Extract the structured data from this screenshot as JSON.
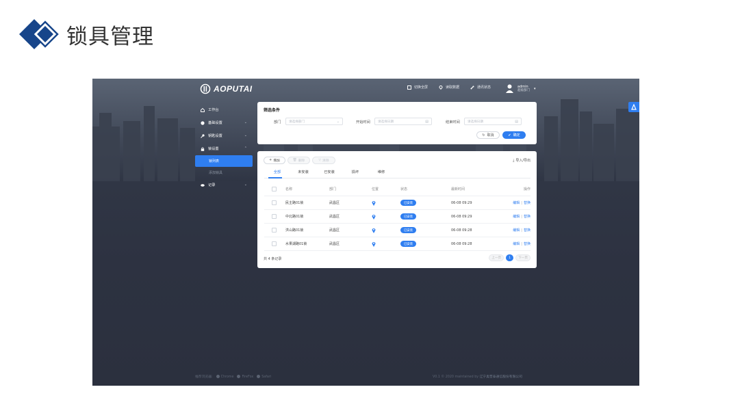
{
  "slide": {
    "title": "锁具管理"
  },
  "app": {
    "brand": "AOPUTAI",
    "top_actions": [
      {
        "label": "切换全屏",
        "icon": "fullscreen-icon"
      },
      {
        "label": "读取数据",
        "icon": "read-data-icon"
      },
      {
        "label": "通讯状态",
        "icon": "connection-icon"
      }
    ],
    "user": {
      "name": "admin",
      "dept": "超级部门"
    },
    "colors": {
      "accent": "#2f7ef0",
      "bg": "#2d3241"
    }
  },
  "sidebar": {
    "items": [
      {
        "label": "工作台",
        "icon": "home-icon",
        "arrow": ""
      },
      {
        "label": "基础设置",
        "icon": "settings-icon",
        "arrow": "⌄"
      },
      {
        "label": "钥匙设置",
        "icon": "key-icon",
        "arrow": "⌄"
      },
      {
        "label": "锁设置",
        "icon": "lock-icon",
        "arrow": "⌃"
      }
    ],
    "sub_items": [
      {
        "label": "锁列表"
      },
      {
        "label": "添加锁具"
      }
    ],
    "log": {
      "label": "记录",
      "icon": "eye-icon",
      "arrow": "⌄"
    }
  },
  "filter": {
    "title": "筛选条件",
    "dept_label": "部门",
    "dept_placeholder": "请选择部门",
    "start_label": "开始时间",
    "start_placeholder": "请选择日期",
    "end_label": "结束时间",
    "end_placeholder": "请选择日期",
    "cancel": "取消",
    "confirm": "确定"
  },
  "table": {
    "add": "增加",
    "delete": "删除",
    "clear": "清除",
    "import_export": "导入/导出",
    "tabs": [
      "全部",
      "未安装",
      "已安装",
      "损坏",
      "维修"
    ],
    "headers": {
      "name": "名称",
      "dept": "部门",
      "location": "位置",
      "status": "状态",
      "time": "最新时间",
      "op": "操作"
    },
    "rows": [
      {
        "name": "民主路01锁",
        "dept": "武昌区",
        "status": "已安装",
        "time": "06-08 09:29",
        "edit": "编辑",
        "replace": "替换"
      },
      {
        "name": "中北路01锁",
        "dept": "武昌区",
        "status": "已安装",
        "time": "06-08 09:29",
        "edit": "编辑",
        "replace": "替换"
      },
      {
        "name": "洪山路01锁",
        "dept": "武昌区",
        "status": "已安装",
        "time": "06-08 09:28",
        "edit": "编辑",
        "replace": "替换"
      },
      {
        "name": "水果湖路01锁",
        "dept": "武昌区",
        "status": "已安装",
        "time": "06-08 09:28",
        "edit": "编辑",
        "replace": "替换"
      }
    ],
    "total": "共 4 条记录",
    "pager": {
      "prev": "上一页",
      "current": "1",
      "next": "下一页"
    }
  },
  "footer": {
    "browsers_label": "推荐浏览器:",
    "browsers": [
      "Chrome",
      "FireFox",
      "Safari"
    ],
    "version": "V0.1 © 2020 maintained by",
    "company": "辽宁奥普泰通信股份有限公司"
  }
}
